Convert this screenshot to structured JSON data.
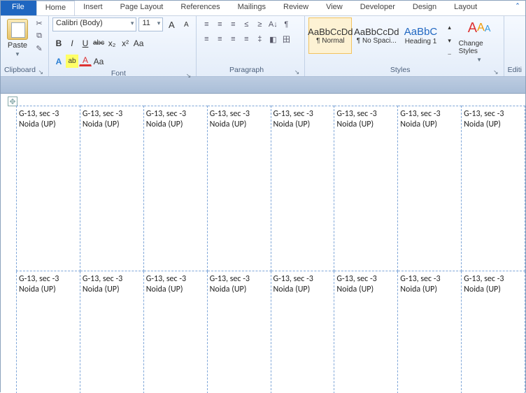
{
  "tabs": [
    "File",
    "Home",
    "Insert",
    "Page Layout",
    "References",
    "Mailings",
    "Review",
    "View",
    "Developer",
    "Design",
    "Layout"
  ],
  "active_tab": "Home",
  "clipboard": {
    "label": "Clipboard",
    "paste": "Paste"
  },
  "font": {
    "label": "Font",
    "name": "Calibri (Body)",
    "size": "11",
    "bold": "B",
    "italic": "I",
    "underline": "U",
    "strike": "abc",
    "sub": "x₂",
    "sup": "x²",
    "effects": "A",
    "highlight": "ab",
    "color": "A",
    "clear": "Aa",
    "case": "Aa",
    "grow": "A",
    "shrink": "A"
  },
  "paragraph": {
    "label": "Paragraph",
    "bullets": "≡",
    "numbers": "≡",
    "multi": "≡",
    "dec": "≤",
    "inc": "≥",
    "sort": "A↓",
    "marks": "¶",
    "al": "≡",
    "ac": "≡",
    "ar": "≡",
    "aj": "≡",
    "ls": "‡",
    "shade": "◧",
    "border": "田"
  },
  "styles": {
    "label": "Styles",
    "items": [
      {
        "preview": "AaBbCcDd",
        "name": "¶ Normal"
      },
      {
        "preview": "AaBbCcDd",
        "name": "¶ No Spaci..."
      },
      {
        "preview": "AaBbC",
        "name": "Heading 1"
      }
    ],
    "change": "Change Styles"
  },
  "editing": {
    "label": "Editi"
  },
  "label_cell": {
    "line1": "G-13, sec -3",
    "line2": "Noida (UP)"
  },
  "rows": 2,
  "cols": 8
}
